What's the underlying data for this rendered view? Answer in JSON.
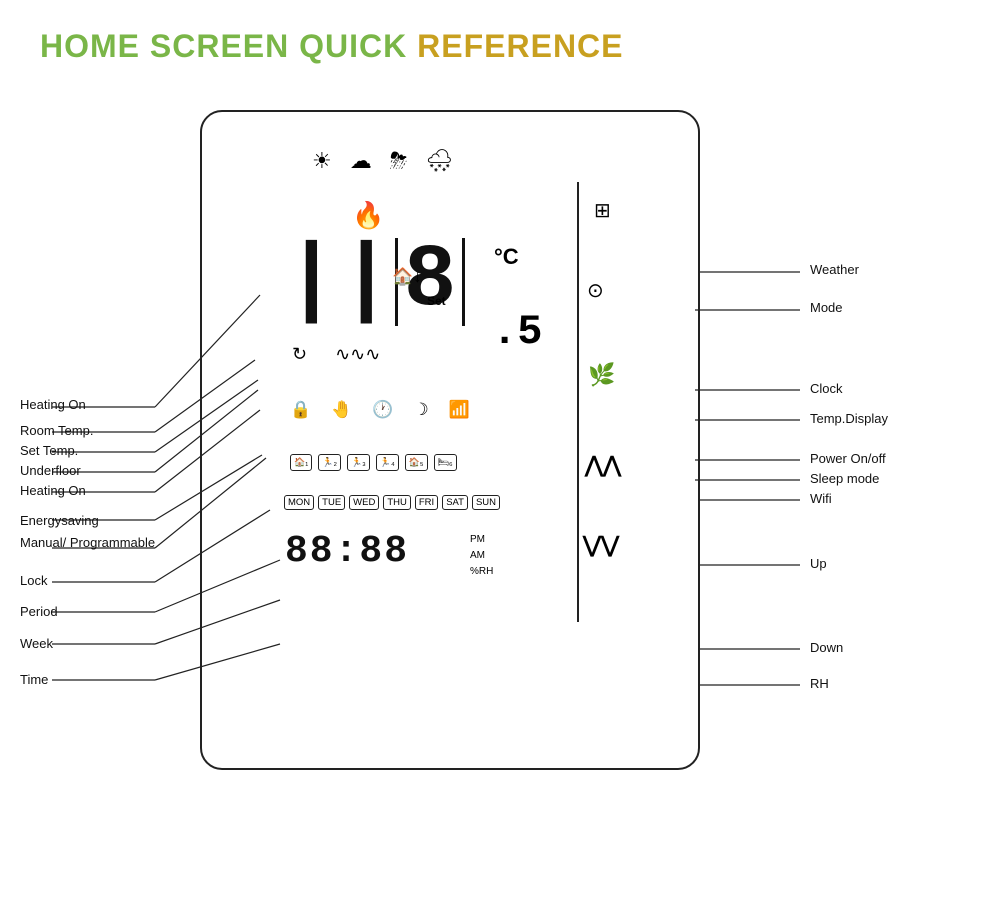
{
  "title": {
    "part1": "HOME SCREEN QUICK",
    "part2": " REFERENCE"
  },
  "labels": {
    "heating_on": "Heating On",
    "room_temp": "Room Temp.",
    "set_temp": "Set  Temp.",
    "underfloor": "Underfloor",
    "heating_on2": "Heating On",
    "energysaving": "Energysaving",
    "manual_prog": "Manual/\nProgrammable",
    "lock": "Lock",
    "period": "Period",
    "week": "Week",
    "time": "Time",
    "weather": "Weather",
    "mode": "Mode",
    "clock": "Clock",
    "temp_display": "Temp.Display",
    "power_onoff": "Power On/off",
    "sleep_mode": "Sleep mode",
    "wifi": "Wifi",
    "up": "Up",
    "down": "Down",
    "rh": "RH"
  },
  "device": {
    "temp_value": "188",
    "temp_unit": "°C",
    "temp_decimal": ".5",
    "set_label": "Set",
    "time_value": "88:88",
    "pm_label": "PM",
    "am_label": "AM",
    "rh_label": "%RH",
    "days": [
      "MON",
      "TUE",
      "WED",
      "THU",
      "FRI",
      "SAT",
      "SUN"
    ],
    "periods": [
      "1",
      "2",
      "3",
      "4",
      "5",
      "6"
    ]
  }
}
